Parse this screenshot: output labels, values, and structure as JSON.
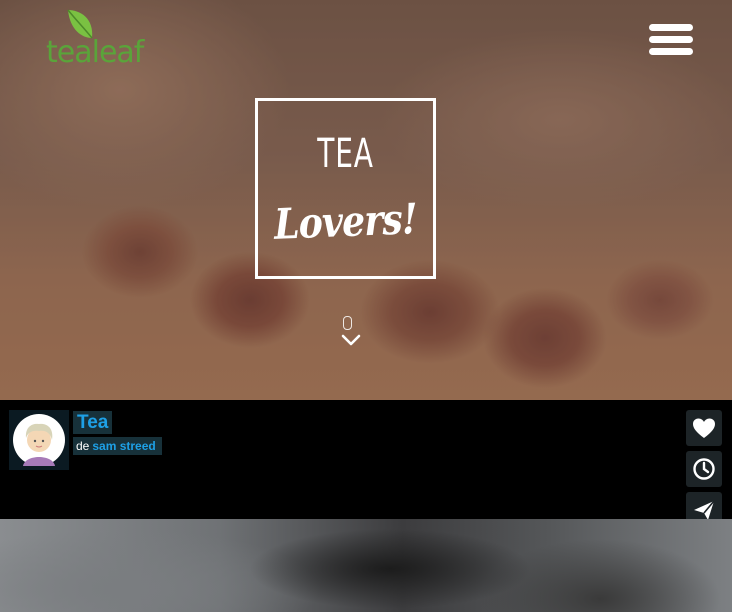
{
  "header": {
    "logo_text": "tealeaf",
    "brand_color": "#5aa43a",
    "menu_icon": "hamburger-menu-icon"
  },
  "hero": {
    "title_line1": "TEA",
    "title_line2": "Lovers!",
    "scroll_icon": "chevron-down-icon"
  },
  "post": {
    "title": "Tea",
    "byline_prefix": "de",
    "author": "sam streed",
    "accent_color": "#1ea0e6"
  },
  "actions": {
    "items": [
      {
        "icon": "heart-icon"
      },
      {
        "icon": "clock-icon"
      },
      {
        "icon": "send-icon"
      }
    ]
  }
}
